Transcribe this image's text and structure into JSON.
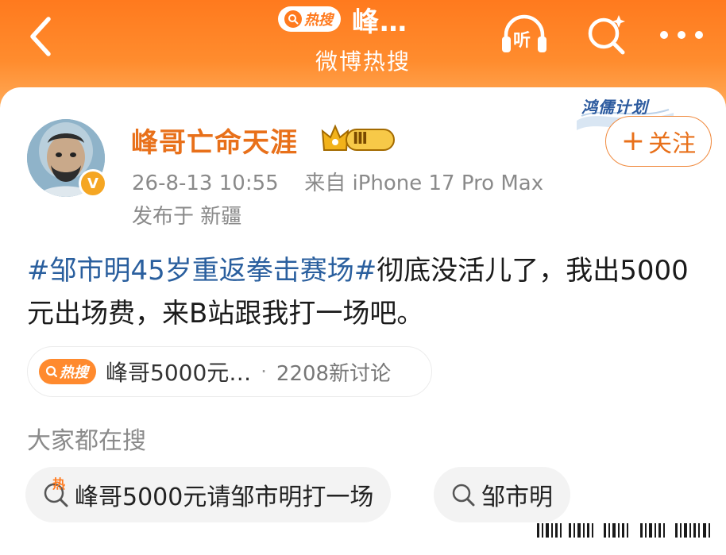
{
  "header": {
    "hot_label": "热搜",
    "title": "峰…",
    "subtitle": "微博热搜",
    "listen_label": "听",
    "accent": "#ff7a1e"
  },
  "watermark": {
    "text": "鸿儒计划"
  },
  "post_author": {
    "name": "峰哥亡命天涯",
    "level": "Ⅲ",
    "verified_badge": "V",
    "timestamp": "26-8-13 10:55",
    "source": "来自 iPhone 17 Pro Max",
    "location": "发布于 新疆",
    "follow_label": "关注",
    "follow_plus": "+"
  },
  "post": {
    "tag": "#邹市明45岁重返拳击赛场#",
    "text": "彻底没活儿了，我出5000元出场费，来B站跟我打一场吧。"
  },
  "hot_topic": {
    "badge": "热搜",
    "title": "峰哥5000元…",
    "dot": "·",
    "count": "2208新讨论"
  },
  "related": {
    "title": "大家都在搜",
    "chips": [
      {
        "label": "峰哥5000元请邹市明打一场",
        "icon": "hot-search-icon",
        "icon_text": "热"
      },
      {
        "label": "邹市明",
        "icon": "search-icon"
      }
    ]
  }
}
